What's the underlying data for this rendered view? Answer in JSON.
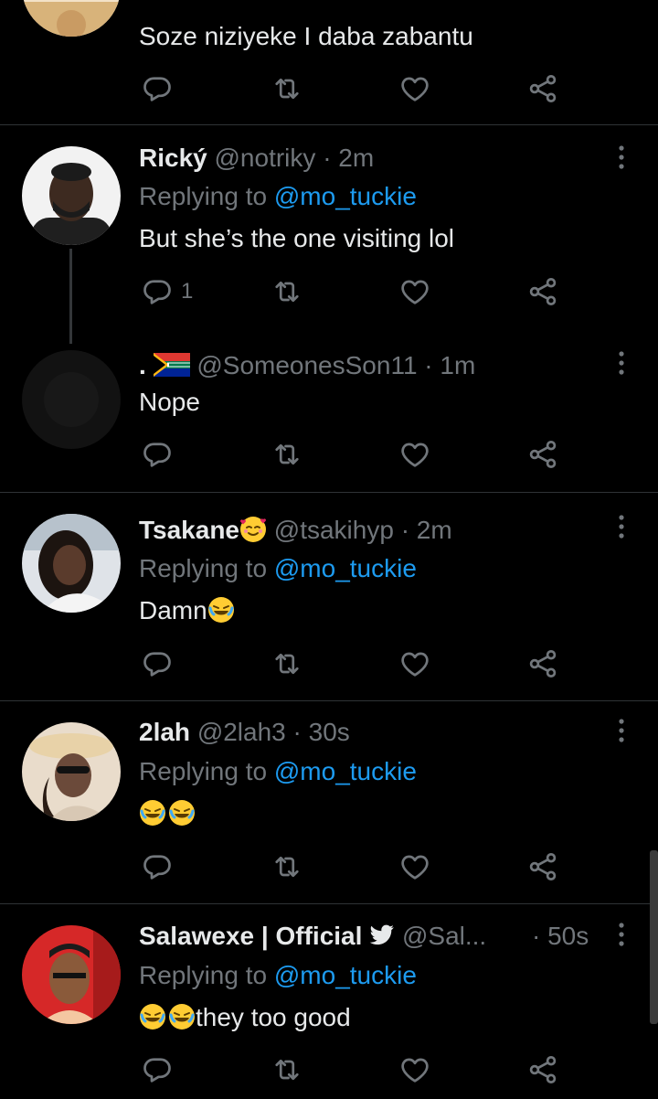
{
  "tweets": [
    {
      "author": "",
      "handle": "",
      "time": "",
      "body": "Soze niziyeke I daba zabantu",
      "reply_count": "",
      "avatar_colors": [
        "#d8b37a",
        "#f3e1c7"
      ]
    },
    {
      "author": "Rický",
      "handle": "@notriky",
      "time": "· 2m",
      "replying_label": "Replying to",
      "replying_to": "@mo_tuckie",
      "body": "But she’s the one visiting lol",
      "reply_count": "1",
      "avatar_colors": [
        "#3d2a20",
        "#f2f2f2"
      ]
    },
    {
      "author": ".",
      "handle": "@SomeonesSon11",
      "time": "· 1m",
      "body": "Nope",
      "reply_count": "",
      "avatar_colors": [
        "#121212",
        "#121212"
      ]
    },
    {
      "author": "Tsakane",
      "handle": "@tsakihyp",
      "time": "· 2m",
      "replying_label": "Replying to",
      "replying_to": "@mo_tuckie",
      "body": "Damn",
      "reply_count": "",
      "avatar_colors": [
        "#5a3b2c",
        "#dfe3e8"
      ]
    },
    {
      "author": "2lah",
      "handle": "@2lah3",
      "time": "· 30s",
      "replying_label": "Replying to",
      "replying_to": "@mo_tuckie",
      "body": "",
      "reply_count": "",
      "avatar_colors": [
        "#6b4a3a",
        "#e9dccb"
      ]
    },
    {
      "author": "Salawexe | Official",
      "handle": "@Sal...",
      "time": "· 50s",
      "replying_label": "Replying to",
      "replying_to": "@mo_tuckie",
      "body": "they too good",
      "reply_count": "",
      "avatar_colors": [
        "#d62828",
        "#f4c7a1"
      ]
    }
  ],
  "icons": {
    "reply": "reply-icon",
    "retweet": "retweet-icon",
    "like": "heart-icon",
    "share": "share-icon",
    "more": "more-icon",
    "verified": "twitter-bird-icon",
    "emoji_love": "smiling-face-with-hearts-emoji",
    "emoji_laugh": "rolling-on-floor-laughing-emoji",
    "flag": "south-africa-flag"
  },
  "colors": {
    "background": "#000000",
    "text": "#e7e9ea",
    "muted": "#71767b",
    "link": "#1d9bf0",
    "divider": "#2f3336"
  }
}
